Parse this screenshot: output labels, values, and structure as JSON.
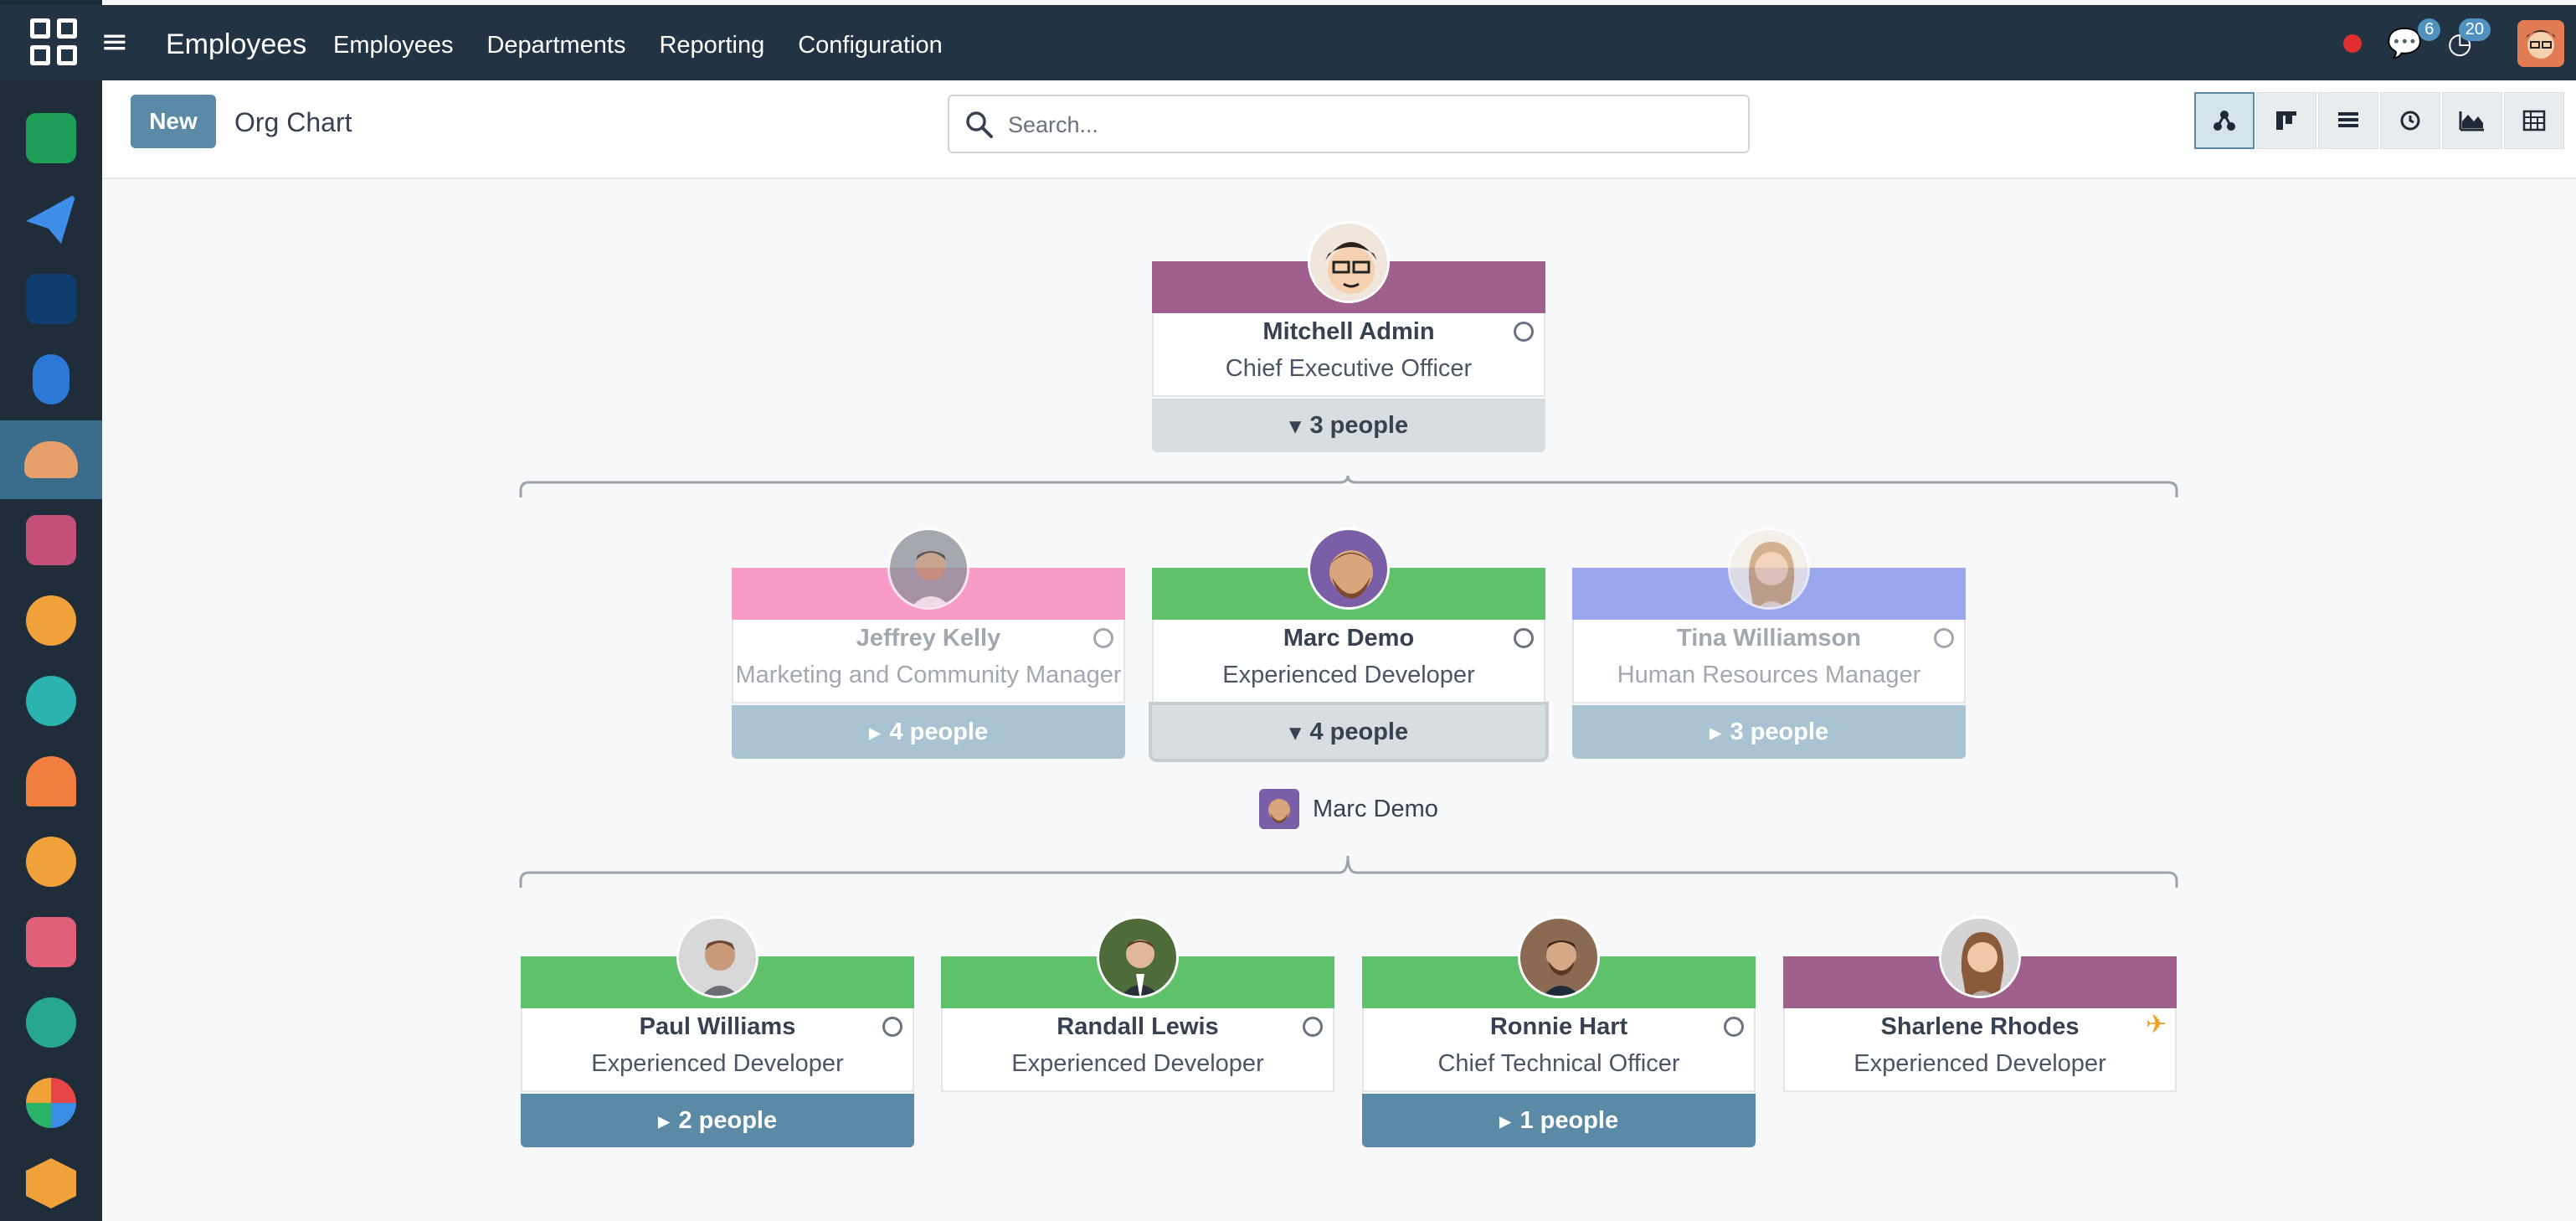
{
  "navbar": {
    "brand": "Employees",
    "menu": [
      "Employees",
      "Departments",
      "Reporting",
      "Configuration"
    ],
    "messages_count": "6",
    "activities_count": "20"
  },
  "control": {
    "new_label": "New",
    "breadcrumb": "Org Chart",
    "search_placeholder": "Search..."
  },
  "org": {
    "manager": {
      "name": "Mitchell Admin",
      "title": "Chief Executive Officer",
      "people": "3 people"
    },
    "peers": [
      {
        "name": "Jeffrey Kelly",
        "title": "Marketing and Community Manager",
        "people": "4 people"
      },
      {
        "name": "Marc Demo",
        "title": "Experienced Developer",
        "people": "4 people"
      },
      {
        "name": "Tina Williamson",
        "title": "Human Resources Manager",
        "people": "3 people"
      }
    ],
    "focus_label": "Marc Demo",
    "subordinates": [
      {
        "name": "Paul Williams",
        "title": "Experienced Developer",
        "people": "2 people"
      },
      {
        "name": "Randall Lewis",
        "title": "Experienced Developer"
      },
      {
        "name": "Ronnie Hart",
        "title": "Chief Technical Officer",
        "people": "1 people"
      },
      {
        "name": "Sharlene Rhodes",
        "title": "Experienced Developer"
      }
    ]
  },
  "colors": {
    "purple": "#a0608d",
    "pink": "#f596c4",
    "green": "#5fc16a",
    "lavender": "#95a2ec",
    "accent": "#5a8aa6"
  },
  "icons": {
    "apps": "apps-grid-icon",
    "menu": "menu-toggle-icon",
    "messages": "chat-icon",
    "activities": "clock-icon",
    "search": "search-icon",
    "views": [
      "hierarchy-icon",
      "kanban-icon",
      "list-icon",
      "activity-icon",
      "graph-icon",
      "pivot-icon"
    ]
  }
}
